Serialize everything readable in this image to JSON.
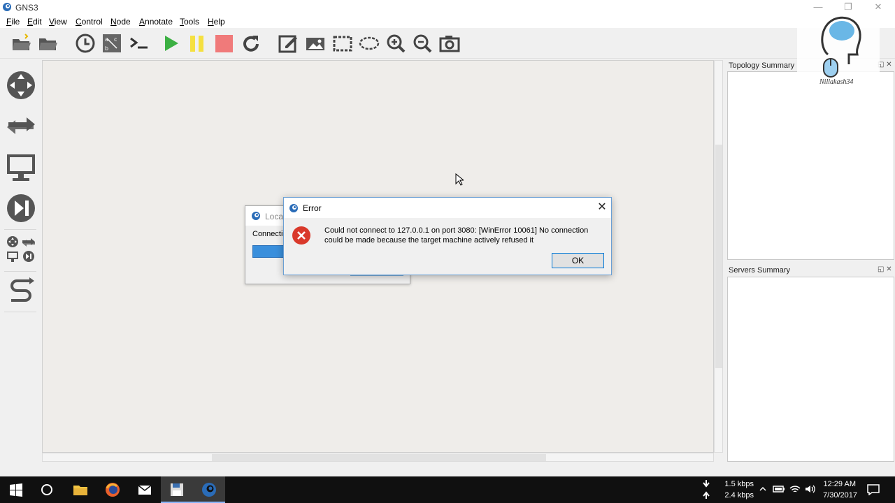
{
  "window": {
    "title": "GNS3",
    "min_glyph": "—",
    "restore_glyph": "❐",
    "close_glyph": "✕"
  },
  "menu": {
    "file": {
      "u": "F",
      "rest": "ile"
    },
    "edit": {
      "u": "E",
      "rest": "dit"
    },
    "view": {
      "u": "V",
      "rest": "iew"
    },
    "control": {
      "u": "C",
      "rest": "ontrol"
    },
    "node": {
      "u": "N",
      "rest": "ode"
    },
    "annotate": {
      "u": "A",
      "rest": "nnotate"
    },
    "tools": {
      "u": "T",
      "rest": "ools"
    },
    "help": {
      "u": "H",
      "rest": "elp"
    }
  },
  "toolbar": [
    "open-project",
    "open-folder",
    "snapshot-clock",
    "show-interface-labels",
    "console",
    "start-all",
    "suspend-all",
    "stop-all",
    "reload-all",
    "add-note",
    "insert-image",
    "draw-rectangle",
    "draw-ellipse",
    "zoom-in",
    "zoom-out",
    "screenshot"
  ],
  "devices": [
    "routers",
    "switches",
    "end-devices",
    "security-devices",
    "all-devices",
    "add-link"
  ],
  "docks": {
    "topology": {
      "title": "Topology Summary",
      "float_glyph": "◱",
      "close_glyph": "✕"
    },
    "servers": {
      "title": "Servers Summary",
      "float_glyph": "◱",
      "close_glyph": "✕"
    }
  },
  "watermark": {
    "text": "Nillakash34"
  },
  "bg_dialog": {
    "title": "Local",
    "message": "Connectin"
  },
  "error_dialog": {
    "title": "Error",
    "close_glyph": "✕",
    "message": "Could not connect to 127.0.0.1 on port 3080: [WinError 10061] No connection could be made because the target machine actively refused it",
    "ok_label": "OK"
  },
  "taskbar": {
    "apps": [
      "start",
      "cortana",
      "file-explorer",
      "firefox",
      "mail",
      "save-app",
      "gns3"
    ],
    "net_down": "1.5 kbps",
    "net_up": "2.4 kbps",
    "time": "12:29 AM",
    "date": "7/30/2017"
  },
  "colors": {
    "play_green": "#3cb043",
    "pause_yellow": "#f5e040",
    "stop_red": "#f07a7a",
    "error_red": "#d9392b",
    "accent_blue": "#0078d7"
  }
}
